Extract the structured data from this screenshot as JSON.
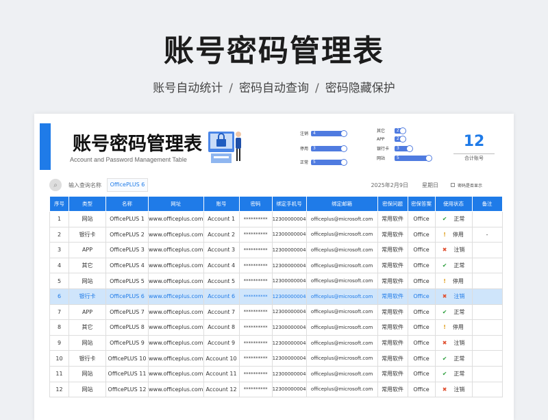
{
  "hero": {
    "title": "账号密码管理表",
    "subtitle": [
      "账号自动统计",
      "密码自动查询",
      "密码隐藏保护"
    ],
    "separator": "/"
  },
  "sheet": {
    "title": "账号密码管理表",
    "subtitle_en": "Account and Password Management Table",
    "accent_color": "#1f7be8",
    "status_bars": [
      {
        "label": "注销",
        "value": "4"
      },
      {
        "label": "停用",
        "value": "3"
      },
      {
        "label": "正常",
        "value": "5"
      }
    ],
    "type_bars": [
      {
        "label": "其它",
        "value": "2"
      },
      {
        "label": "APP",
        "value": "2"
      },
      {
        "label": "银行卡",
        "value": "3"
      },
      {
        "label": "网站",
        "value": "5"
      }
    ],
    "total": {
      "value": "12",
      "label": "合计账号"
    },
    "search": {
      "label": "输入查询名称",
      "value": "OfficePLUS 6"
    },
    "date": "2025年2月9日",
    "weekday": "星期日",
    "password_toggle_label": "密码是否显示"
  },
  "table": {
    "headers": [
      "序号",
      "类型",
      "名称",
      "网址",
      "账号",
      "密码",
      "绑定手机号",
      "绑定邮箱",
      "密保问题",
      "密保答案",
      "使用状态",
      "备注"
    ],
    "rows": [
      {
        "no": "1",
        "type": "网站",
        "name": "OfficePLUS 1",
        "url": "www.officeplus.com",
        "account": "Account 1",
        "pwd": "**********",
        "phone": "12300000004",
        "email": "officeplus@microsoft.com",
        "q": "常用软件",
        "a": "Office",
        "icon": "ok",
        "status": "正常",
        "note": ""
      },
      {
        "no": "2",
        "type": "银行卡",
        "name": "OfficePLUS 2",
        "url": "www.officeplus.com",
        "account": "Account 2",
        "pwd": "**********",
        "phone": "12300000004",
        "email": "officeplus@microsoft.com",
        "q": "常用软件",
        "a": "Office",
        "icon": "warn",
        "status": "停用",
        "note": "-"
      },
      {
        "no": "3",
        "type": "APP",
        "name": "OfficePLUS 3",
        "url": "www.officeplus.com",
        "account": "Account 3",
        "pwd": "**********",
        "phone": "12300000004",
        "email": "officeplus@microsoft.com",
        "q": "常用软件",
        "a": "Office",
        "icon": "x",
        "status": "注销",
        "note": ""
      },
      {
        "no": "4",
        "type": "其它",
        "name": "OfficePLUS 4",
        "url": "www.officeplus.com",
        "account": "Account 4",
        "pwd": "**********",
        "phone": "12300000004",
        "email": "officeplus@microsoft.com",
        "q": "常用软件",
        "a": "Office",
        "icon": "ok",
        "status": "正常",
        "note": ""
      },
      {
        "no": "5",
        "type": "网站",
        "name": "OfficePLUS 5",
        "url": "www.officeplus.com",
        "account": "Account 5",
        "pwd": "**********",
        "phone": "12300000004",
        "email": "officeplus@microsoft.com",
        "q": "常用软件",
        "a": "Office",
        "icon": "warn",
        "status": "停用",
        "note": ""
      },
      {
        "no": "6",
        "type": "银行卡",
        "name": "OfficePLUS 6",
        "url": "www.officeplus.com",
        "account": "Account 6",
        "pwd": "**********",
        "phone": "12300000004",
        "email": "officeplus@microsoft.com",
        "q": "常用软件",
        "a": "Office",
        "icon": "x",
        "status": "注销",
        "note": ""
      },
      {
        "no": "7",
        "type": "APP",
        "name": "OfficePLUS 7",
        "url": "www.officeplus.com",
        "account": "Account 7",
        "pwd": "**********",
        "phone": "12300000004",
        "email": "officeplus@microsoft.com",
        "q": "常用软件",
        "a": "Office",
        "icon": "ok",
        "status": "正常",
        "note": ""
      },
      {
        "no": "8",
        "type": "其它",
        "name": "OfficePLUS 8",
        "url": "www.officeplus.com",
        "account": "Account 8",
        "pwd": "**********",
        "phone": "12300000004",
        "email": "officeplus@microsoft.com",
        "q": "常用软件",
        "a": "Office",
        "icon": "warn",
        "status": "停用",
        "note": ""
      },
      {
        "no": "9",
        "type": "网站",
        "name": "OfficePLUS 9",
        "url": "www.officeplus.com",
        "account": "Account 9",
        "pwd": "**********",
        "phone": "12300000004",
        "email": "officeplus@microsoft.com",
        "q": "常用软件",
        "a": "Office",
        "icon": "x",
        "status": "注销",
        "note": ""
      },
      {
        "no": "10",
        "type": "银行卡",
        "name": "OfficePLUS 10",
        "url": "www.officeplus.com",
        "account": "Account 10",
        "pwd": "**********",
        "phone": "12300000004",
        "email": "officeplus@microsoft.com",
        "q": "常用软件",
        "a": "Office",
        "icon": "ok",
        "status": "正常",
        "note": ""
      },
      {
        "no": "11",
        "type": "网站",
        "name": "OfficePLUS 11",
        "url": "www.officeplus.com",
        "account": "Account 11",
        "pwd": "**********",
        "phone": "12300000004",
        "email": "officeplus@microsoft.com",
        "q": "常用软件",
        "a": "Office",
        "icon": "ok",
        "status": "正常",
        "note": ""
      },
      {
        "no": "12",
        "type": "网站",
        "name": "OfficePLUS 12",
        "url": "www.officeplus.com",
        "account": "Account 12",
        "pwd": "**********",
        "phone": "12300000004",
        "email": "officeplus@microsoft.com",
        "q": "常用软件",
        "a": "Office",
        "icon": "x",
        "status": "注销",
        "note": ""
      }
    ],
    "highlight_row": 5
  }
}
